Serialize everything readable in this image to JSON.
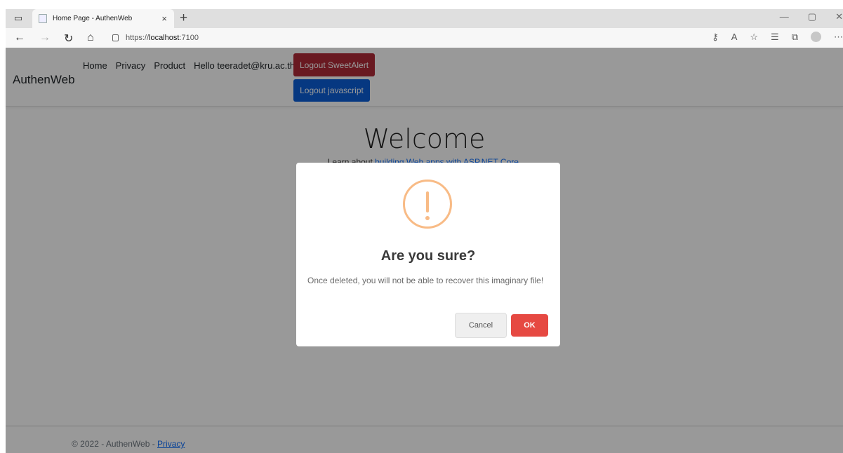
{
  "browser": {
    "tab_title": "Home Page - AuthenWeb",
    "tab_close": "×",
    "new_tab": "+",
    "url_prefix": "https://",
    "url_host": "localhost",
    "url_port": ":7100",
    "win_min": "—",
    "win_restore": "▢",
    "win_close": "✕"
  },
  "site": {
    "brand": "AuthenWeb",
    "nav": [
      "Home",
      "Privacy",
      "Product",
      "Hello teeradet@kru.ac.th!"
    ],
    "logout_sweetalert": "Logout SweetAlert",
    "logout_javascript": "Logout javascript",
    "welcome": "Welcome",
    "learn_prefix": "Learn about ",
    "learn_link": "building Web apps with ASP.NET Core",
    "learn_suffix": ".",
    "footer_text": "© 2022 - AuthenWeb - ",
    "footer_link": "Privacy"
  },
  "modal": {
    "title": "Are you sure?",
    "text": "Once deleted, you will not be able to recover this imaginary file!",
    "cancel": "Cancel",
    "ok": "OK"
  },
  "colors": {
    "warning": "#f8bb86",
    "ok_button": "#e64942",
    "logout_red": "#b02a37",
    "logout_blue": "#0b5ed7"
  }
}
